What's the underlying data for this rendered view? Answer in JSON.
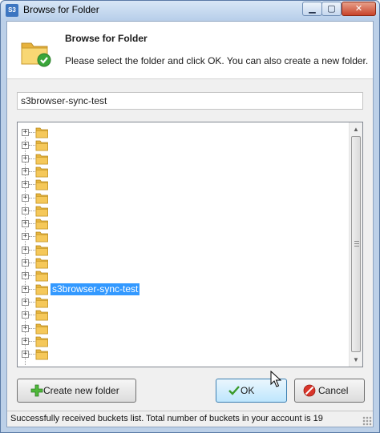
{
  "window": {
    "title": "Browse for Folder",
    "app_icon_text": "S3",
    "controls": {
      "minimize": "▁",
      "maximize": "▢",
      "close": "✕"
    }
  },
  "header": {
    "title": "Browse for Folder",
    "description": "Please select the folder and click OK. You can also create a new folder.",
    "icon": "folder-check-icon"
  },
  "path_field": {
    "value": "s3browser-sync-test"
  },
  "tree": {
    "nodes": [
      {
        "label": "",
        "blurred": true,
        "selected": false
      },
      {
        "label": "",
        "blurred": true,
        "selected": false
      },
      {
        "label": "",
        "blurred": true,
        "selected": false
      },
      {
        "label": "",
        "blurred": true,
        "selected": false
      },
      {
        "label": "",
        "blurred": true,
        "selected": false
      },
      {
        "label": "",
        "blurred": true,
        "selected": false
      },
      {
        "label": "",
        "blurred": true,
        "selected": false
      },
      {
        "label": "",
        "blurred": true,
        "selected": false
      },
      {
        "label": "",
        "blurred": true,
        "selected": false
      },
      {
        "label": "",
        "blurred": true,
        "selected": false
      },
      {
        "label": "",
        "blurred": true,
        "selected": false
      },
      {
        "label": "",
        "blurred": true,
        "selected": false
      },
      {
        "label": "s3browser-sync-test",
        "blurred": false,
        "selected": true
      },
      {
        "label": "",
        "blurred": true,
        "selected": false
      },
      {
        "label": "",
        "blurred": true,
        "selected": false
      },
      {
        "label": "",
        "blurred": true,
        "selected": false
      },
      {
        "label": "",
        "blurred": true,
        "selected": false
      },
      {
        "label": "",
        "blurred": true,
        "selected": false
      }
    ],
    "expander_symbol": "+"
  },
  "buttons": {
    "create_new_folder": "Create new folder",
    "ok": "OK",
    "cancel": "Cancel"
  },
  "status": {
    "text": "Successfully received buckets list. Total number of buckets in your account is 19"
  },
  "colors": {
    "selection": "#3399ff",
    "folder": "#f5c85a",
    "accent": "#3c7fb1"
  }
}
